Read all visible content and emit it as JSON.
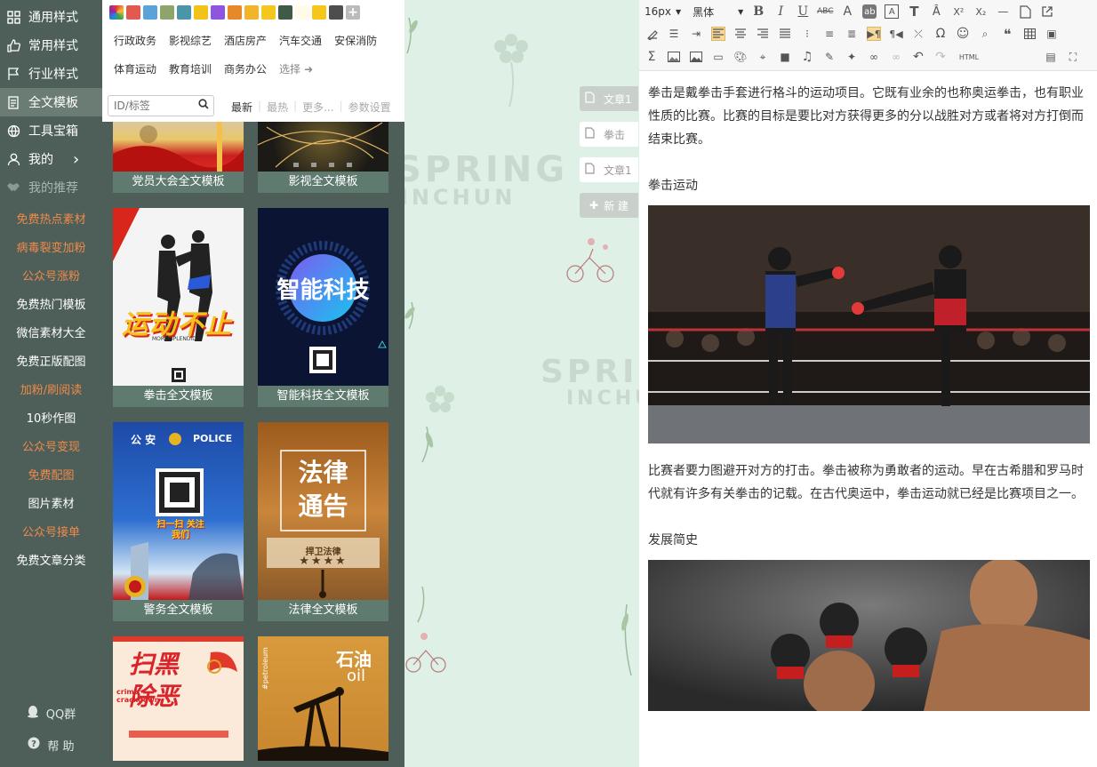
{
  "leftnav": {
    "items": [
      {
        "label": "通用样式",
        "icon": "grid-icon"
      },
      {
        "label": "常用样式",
        "icon": "thumbs-up-icon"
      },
      {
        "label": "行业样式",
        "icon": "flag-icon"
      },
      {
        "label": "全文模板",
        "icon": "document-icon"
      },
      {
        "label": "工具宝箱",
        "icon": "globe-icon"
      },
      {
        "label": "我的",
        "icon": "user-icon"
      },
      {
        "label": "我的推荐",
        "icon": "handshake-icon"
      }
    ],
    "promos": [
      {
        "label": "免费热点素材",
        "color": "orange"
      },
      {
        "label": "病毒裂变加粉",
        "color": "orange"
      },
      {
        "label": "公众号涨粉",
        "color": "orange"
      },
      {
        "label": "免费热门模板",
        "color": "white"
      },
      {
        "label": "微信素材大全",
        "color": "white"
      },
      {
        "label": "免费正版配图",
        "color": "white"
      },
      {
        "label": "加粉/刷阅读",
        "color": "orange"
      },
      {
        "label": "10秒作图",
        "color": "white"
      },
      {
        "label": "公众号变现",
        "color": "orange"
      },
      {
        "label": "免费配图",
        "color": "orange"
      },
      {
        "label": "图片素材",
        "color": "white"
      },
      {
        "label": "公众号接单",
        "color": "orange"
      },
      {
        "label": "免费文章分类",
        "color": "white"
      }
    ],
    "qq_label": "QQ群",
    "help_label": "帮  助"
  },
  "colors": {
    "sidebar": "#4d5f58",
    "orange_text": "#f08a4b",
    "swatches": [
      "#e05a50",
      "#5aa3d8",
      "#8fa46b",
      "#4a95a8",
      "#f2c21a",
      "#8f55e0",
      "#e6892a",
      "#f2b52a",
      "#f4c720",
      "#3f5a47",
      "#fffbe8",
      "#f6c71a",
      "#4d4f4e"
    ]
  },
  "templates": {
    "categories": [
      "行政政务",
      "影视综艺",
      "酒店房产",
      "汽车交通",
      "安保消防",
      "体育运动",
      "教育培训",
      "商务办公"
    ],
    "select_label": "选择",
    "search_placeholder": "ID/标签",
    "sorts": [
      "最新",
      "最热",
      "更多...",
      "参数设置"
    ],
    "cards": [
      {
        "caption": "党员大会全文模板"
      },
      {
        "caption": "影视全文模板"
      },
      {
        "caption": "拳击全文模板",
        "poster_title": "运动不止",
        "poster_tag": "MORE SPLENDID"
      },
      {
        "caption": "智能科技全文模板",
        "poster_title": "智能科技"
      },
      {
        "caption": "警务全文模板",
        "poster_title": "公 安",
        "poster_tag": "POLICE",
        "poster_sub": "扫一扫 关注我们"
      },
      {
        "caption": "法律全文模板",
        "poster_title": "法律\n通告",
        "poster_sub": "捍卫法律",
        "poster_stars": "★★★★"
      },
      {
        "caption": "",
        "poster_title": "扫黑\n除恶",
        "poster_tag": "crime crackdown"
      },
      {
        "caption": "",
        "poster_title": "石油",
        "poster_tag": "oil",
        "poster_sub": "#petroleum"
      }
    ]
  },
  "canvas": {
    "watermark_main": "SPRING",
    "watermark_sub": "INCHUN",
    "doc_tabs": [
      {
        "label": "文章1",
        "selected": true
      },
      {
        "label": "拳击",
        "selected": false
      },
      {
        "label": "文章1",
        "selected": false
      }
    ],
    "new_label": "新  建"
  },
  "editor": {
    "font_size": "16px",
    "font_family": "黑体",
    "paragraphs": [
      "拳击是戴拳击手套进行格斗的运动项目。它既有业余的也称奥运拳击，也有职业性质的比赛。比赛的目标是要比对方获得更多的分以战胜对方或者将对方打倒而结束比赛。",
      "拳击运动",
      "比赛者要力图避开对方的打击。拳击被称为勇敢者的运动。早在古希腊和罗马时代就有许多有关拳击的记载。在古代奥运中，拳击运动就已经是比赛项目之一。",
      "发展简史"
    ],
    "html_label": "HTML"
  }
}
